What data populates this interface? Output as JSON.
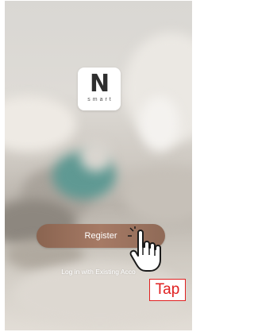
{
  "logo": {
    "letter": "N",
    "subtitle": "smart"
  },
  "register": {
    "label": "Register"
  },
  "login": {
    "label": "Log in with Existing Acco"
  },
  "annotation": {
    "tap_label": "Tap"
  },
  "icons": {
    "pointer": "hand-pointer-icon"
  },
  "colors": {
    "accent_button": "#a67a65",
    "annotation_red": "#e02020"
  }
}
